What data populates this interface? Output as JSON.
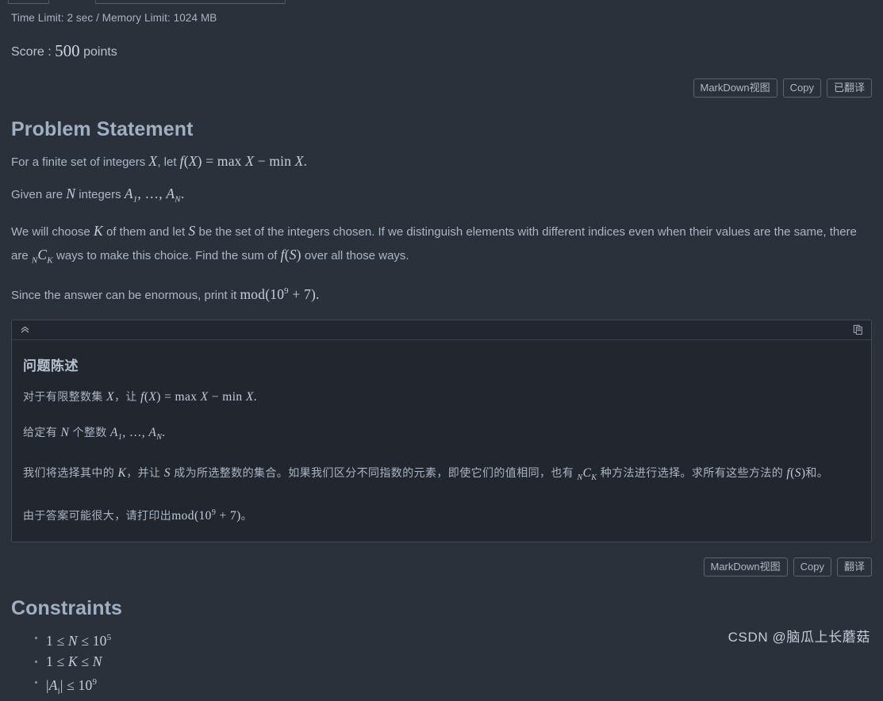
{
  "header": {
    "limits": "Time Limit: 2 sec / Memory Limit: 1024 MB",
    "score_label": "Score :",
    "score_value": "500",
    "score_unit": "points"
  },
  "toolbar_top": {
    "markdown_label": "MarkDown视图",
    "copy_label": "Copy",
    "translate_label": "已翻译"
  },
  "toolbar_bottom": {
    "markdown_label": "MarkDown视图",
    "copy_label": "Copy",
    "translate_label": "翻译"
  },
  "problem": {
    "heading": "Problem Statement",
    "p1_a": "For a finite set of integers",
    "p1_var": "X",
    "p1_b": ", let",
    "p1_math": "f(X) = max X − min X",
    "p1_c": ".",
    "p2_a": "Given are",
    "p2_var": "N",
    "p2_b": "integers",
    "p2_math": "A1, …, AN",
    "p2_c": ".",
    "p3_a": "We will choose",
    "p3_var1": "K",
    "p3_b": "of them and let",
    "p3_var2": "S",
    "p3_c": "be the set of the integers chosen. If we distinguish elements with different indices even when their values are the same, there are",
    "p3_math": "NCK",
    "p3_d": "ways to make this choice. Find the sum of",
    "p3_math2": "f(S)",
    "p3_e": "over all those ways.",
    "p4_a": "Since the answer can be enormous, print it",
    "p4_math": "mod(10^9 + 7)",
    "p4_b": "."
  },
  "translation": {
    "collapse_icon": "chevrons-up-icon",
    "copy_icon": "copy-icon",
    "heading": "问题陈述",
    "p1_a": "对于有限整数集",
    "p1_var": "X",
    "p1_b": "，让",
    "p1_math": "f(X) = max X − min X",
    "p1_c": ".",
    "p2_a": "给定有",
    "p2_var": "N",
    "p2_b": "个整数",
    "p2_math": "A1, …, AN",
    "p2_c": ".",
    "p3_a": "我们将选择其中的",
    "p3_var1": "K",
    "p3_b": "，并让",
    "p3_var2": "S",
    "p3_c": "成为所选整数的集合。如果我们区分不同指数的元素，即使它们的值相同，也有",
    "p3_math": "NCK",
    "p3_d": "种方法进行选择。求所有这些方法的",
    "p3_math2": "f(S)",
    "p3_e": "和。",
    "p4_a": "由于答案可能很大，请打印出",
    "p4_math": "mod(10^9 + 7)",
    "p4_b": "。"
  },
  "constraints": {
    "heading": "Constraints",
    "items": [
      "1 ≤ N ≤ 10^5",
      "1 ≤ K ≤ N",
      "|A_i| ≤ 10^9"
    ]
  },
  "watermark": {
    "text": "CSDN @脑瓜上长蘑菇"
  }
}
